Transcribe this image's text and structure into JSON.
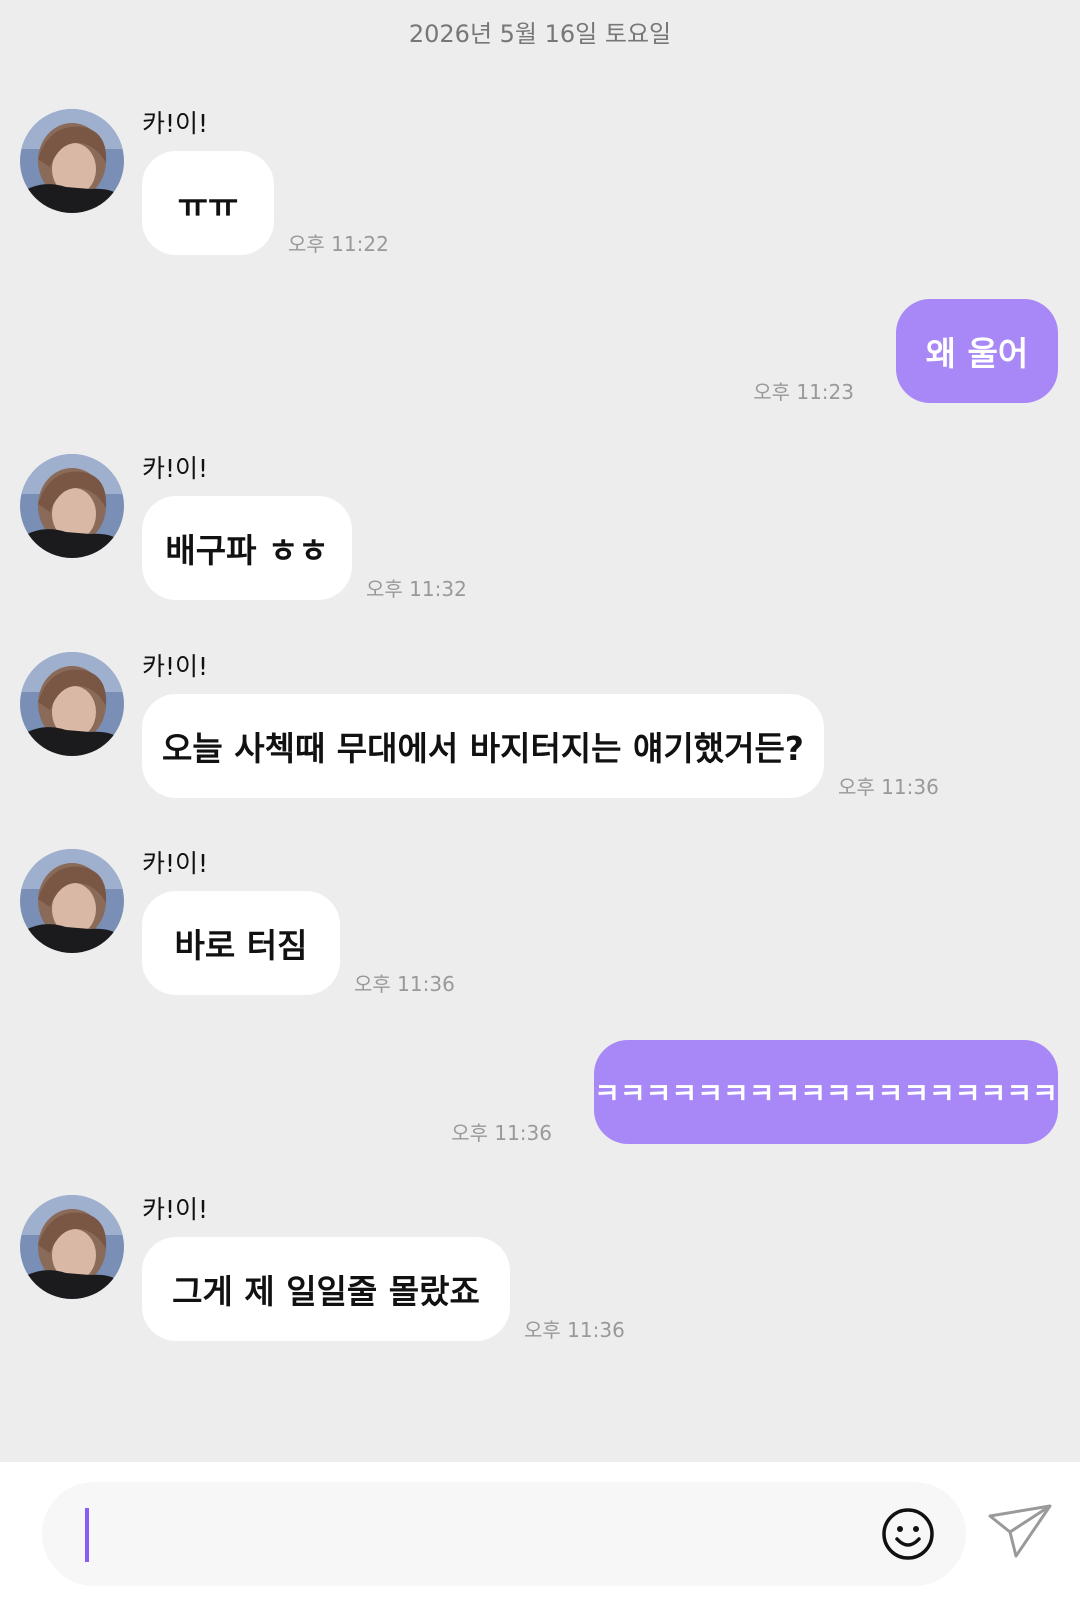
{
  "date_header": "2026년 5월 16일 토요일",
  "sender_name": "카!이!",
  "messages": [
    {
      "text": "ㅠㅠ",
      "time": "오후 11:22"
    },
    {
      "text": "왜 울어",
      "time": "오후 11:23"
    },
    {
      "text": "배구파 ㅎㅎ",
      "time": "오후 11:32"
    },
    {
      "text": "오늘 사첵때 무대에서 바지터지는 얘기했거든?",
      "time": "오후 11:36"
    },
    {
      "text": "바로 터짐",
      "time": "오후 11:36"
    },
    {
      "text": "ㅋㅋㅋㅋㅋㅋㅋㅋㅋㅋㅋㅋㅋㅋㅋㅋㅋㅋ",
      "time": "오후 11:36"
    },
    {
      "text": "그게 제 일일줄 몰랐죠",
      "time": "오후 11:36"
    }
  ],
  "composer": {
    "value": "",
    "emoji_icon": "smiley-icon",
    "send_icon": "paper-plane-icon"
  },
  "colors": {
    "background": "#ededed",
    "outgoing_bubble": "#a788f6",
    "incoming_bubble": "#ffffff",
    "caret": "#8a5cf5"
  }
}
